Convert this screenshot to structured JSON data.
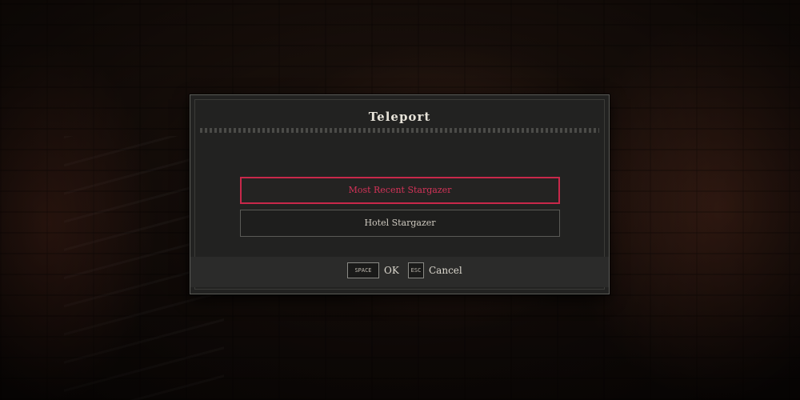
{
  "dialog": {
    "title": "Teleport",
    "options": [
      {
        "label": "Most Recent Stargazer",
        "selected": true
      },
      {
        "label": "Hotel Stargazer",
        "selected": false
      }
    ],
    "footer": {
      "ok_key": "SPACE",
      "ok_label": "OK",
      "cancel_key": "ESC",
      "cancel_label": "Cancel"
    }
  },
  "colors": {
    "selected_accent": "#c8284a",
    "panel_bg": "#222221",
    "text": "#dcd8ce"
  }
}
